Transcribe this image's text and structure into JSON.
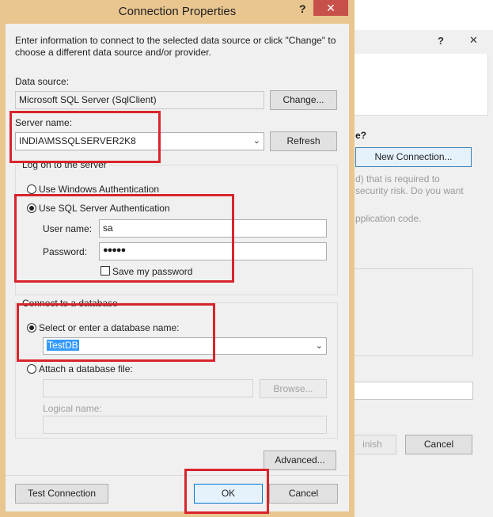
{
  "window": {
    "title": "Connection Properties",
    "help_label": "?",
    "close_label": "✕"
  },
  "intro": "Enter information to connect to the selected data source or click \"Change\" to choose a different data source and/or provider.",
  "data_source": {
    "label": "Data source:",
    "value": "Microsoft SQL Server (SqlClient)",
    "change_label": "Change..."
  },
  "server": {
    "label": "Server name:",
    "value": "INDIA\\MSSQLSERVER2K8",
    "refresh_label": "Refresh"
  },
  "logon": {
    "group_label": "Log on to the server",
    "windows_auth_label": "Use Windows Authentication",
    "sql_auth_label": "Use SQL Server Authentication",
    "selected": "sql",
    "user_label": "User name:",
    "user_value": "sa",
    "password_label": "Password:",
    "password_value": "●●●●●",
    "save_password_label": "Save my password",
    "save_password_checked": false
  },
  "database": {
    "group_label": "Connect to a database",
    "select_label": "Select or enter a database name:",
    "db_value": "TestDB",
    "attach_label": "Attach a database file:",
    "browse_label": "Browse...",
    "logical_label": "Logical name:"
  },
  "buttons": {
    "advanced": "Advanced...",
    "test": "Test Connection",
    "ok": "OK",
    "cancel": "Cancel"
  },
  "background_dialog": {
    "help_label": "?",
    "close_label": "✕",
    "text_question": "e?",
    "new_connection": "New Connection...",
    "text_line1": "d) that is required to",
    "text_line2": "security risk. Do you want",
    "text_line3": "pplication code.",
    "finish_label": "inish",
    "cancel_label": "Cancel"
  },
  "colors": {
    "frame": "#e9c690",
    "annotation_red": "#d9242c",
    "selection_blue": "#3399ff"
  }
}
